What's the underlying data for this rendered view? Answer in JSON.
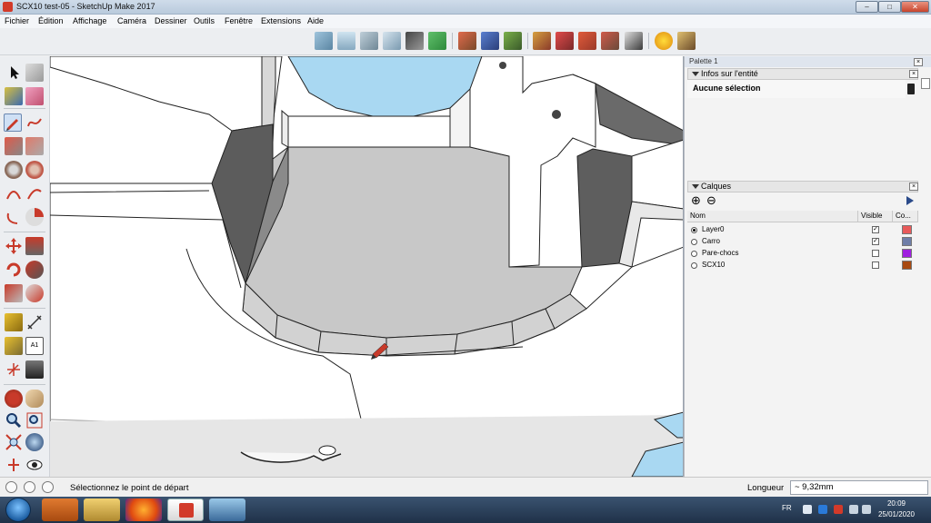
{
  "window": {
    "title": "SCX10 test-05 - SketchUp Make 2017",
    "minimize_glyph": "–",
    "maximize_glyph": "□",
    "close_glyph": "✕"
  },
  "menu": [
    "Fichier",
    "Édition",
    "Affichage",
    "Caméra",
    "Dessiner",
    "Outils",
    "Fenêtre",
    "Extensions",
    "Aide"
  ],
  "panel": {
    "title": "Palette 1",
    "close_glyph": "×",
    "entity_info": {
      "header": "Infos sur l'entité",
      "selection": "Aucune sélection"
    },
    "layers": {
      "header": "Calques",
      "add_glyph": "⊕",
      "remove_glyph": "⊖",
      "columns": {
        "name": "Nom",
        "visible": "Visible",
        "color": "Co..."
      },
      "rows": [
        {
          "name": "Layer0",
          "active": true,
          "visible": true,
          "color": "#e85a5a"
        },
        {
          "name": "Carro",
          "active": false,
          "visible": true,
          "color": "#6f7ea8"
        },
        {
          "name": "Pare-chocs",
          "active": false,
          "visible": false,
          "color": "#a020e0"
        },
        {
          "name": "SCX10",
          "active": false,
          "visible": false,
          "color": "#a84a12"
        }
      ],
      "check_glyph": "✓"
    }
  },
  "status": {
    "message": "Sélectionnez le point de départ",
    "measure_label": "Longueur",
    "measure_value": "~ 9,32mm"
  },
  "taskbar": {
    "lang": "FR",
    "time": "20:09",
    "date": "25/01/2020"
  },
  "icons": {
    "toolbar": [
      "iso-view-icon",
      "top-view-icon",
      "front-view-icon",
      "right-view-icon",
      "back-view-icon",
      "left-view-icon",
      "bottom-view-icon",
      "sandbox-from-contours-icon",
      "sandbox-from-scratch-icon",
      "smoove-icon",
      "stamp-icon",
      "drape-icon",
      "add-detail-icon",
      "flip-edge-icon",
      "geo-location-icon",
      "extension-warehouse-icon"
    ],
    "left_tools": [
      "select-icon",
      "make-component-icon",
      "paint-bucket-icon",
      "eraser-icon",
      "pencil-icon",
      "freehand-icon",
      "rectangle-icon",
      "rotated-rectangle-icon",
      "circle-icon",
      "polygon-icon",
      "arc-icon",
      "two-point-arc-icon",
      "three-point-arc-icon",
      "pie-icon",
      "move-icon",
      "push-pull-icon",
      "rotate-icon",
      "follow-me-icon",
      "scale-icon",
      "offset-icon",
      "tape-measure-icon",
      "dimension-icon",
      "protractor-icon",
      "text-icon",
      "axes-icon",
      "3d-text-icon",
      "orbit-icon",
      "pan-icon",
      "zoom-icon",
      "zoom-window-icon",
      "zoom-extents-icon",
      "previous-view-icon",
      "position-camera-icon",
      "look-around-icon"
    ]
  },
  "colors": {
    "sky": "#a9d8f2",
    "surface_gray": "#c8c8c8",
    "dark_face": "#5c5c5c",
    "brand_red": "#d23a2a"
  }
}
